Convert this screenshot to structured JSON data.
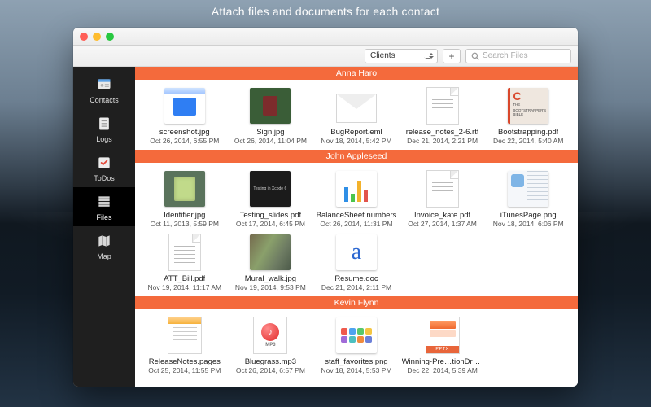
{
  "banner": "Attach files and documents for each contact",
  "toolbar": {
    "selector_value": "Clients",
    "plus_label": "+",
    "search_placeholder": "Search Files"
  },
  "sidebar": {
    "items": [
      {
        "key": "contacts",
        "label": "Contacts"
      },
      {
        "key": "logs",
        "label": "Logs"
      },
      {
        "key": "todos",
        "label": "ToDos"
      },
      {
        "key": "files",
        "label": "Files"
      },
      {
        "key": "map",
        "label": "Map"
      }
    ],
    "active": "files"
  },
  "sections": [
    {
      "title": "Anna Haro",
      "files": [
        {
          "name": "screenshot.jpg",
          "date": "Oct 26, 2014, 6:55 PM",
          "thumb": "ph-app"
        },
        {
          "name": "Sign.jpg",
          "date": "Oct 26, 2014, 11:04 PM",
          "thumb": "sign"
        },
        {
          "name": "BugReport.eml",
          "date": "Nov 18, 2014, 5:42 PM",
          "thumb": "envelope"
        },
        {
          "name": "release_notes_2-6.rtf",
          "date": "Dec 21, 2014, 2:21 PM",
          "thumb": "doc"
        },
        {
          "name": "Bootstrapping.pdf",
          "date": "Dec 22, 2014, 5:40 AM",
          "thumb": "book"
        }
      ]
    },
    {
      "title": "John Appleseed",
      "files": [
        {
          "name": "Identifier.jpg",
          "date": "Oct 11, 2013, 5:59 PM",
          "thumb": "photo"
        },
        {
          "name": "Testing_slides.pdf",
          "date": "Oct 17, 2014, 6:45 PM",
          "thumb": "slide"
        },
        {
          "name": "BalanceSheet.numbers",
          "date": "Oct 26, 2014, 11:31 PM",
          "thumb": "chart"
        },
        {
          "name": "Invoice_kate.pdf",
          "date": "Oct 27, 2014, 1:37 AM",
          "thumb": "doc"
        },
        {
          "name": "iTunesPage.png",
          "date": "Nov 18, 2014, 6:06 PM",
          "thumb": "webpg"
        },
        {
          "name": "ATT_Bill.pdf",
          "date": "Nov 19, 2014, 11:17 AM",
          "thumb": "doc"
        },
        {
          "name": "Mural_walk.jpg",
          "date": "Nov 19, 2014, 9:53 PM",
          "thumb": "mural"
        },
        {
          "name": "Resume.doc",
          "date": "Dec 21, 2014, 2:11 PM",
          "thumb": "letter"
        }
      ]
    },
    {
      "title": "Kevin Flynn",
      "files": [
        {
          "name": "ReleaseNotes.pages",
          "date": "Oct 25, 2014, 11:55 PM",
          "thumb": "pages"
        },
        {
          "name": "Bluegrass.mp3",
          "date": "Oct 26, 2014, 6:57 PM",
          "thumb": "mp3"
        },
        {
          "name": "staff_favorites.png",
          "date": "Nov 18, 2014, 5:53 PM",
          "thumb": "favicons"
        },
        {
          "name": "Winning-Pre…tionDraft.pptx",
          "date": "Dec 22, 2014, 5:39 AM",
          "thumb": "pptx"
        }
      ]
    }
  ],
  "mp3_label": "MP3",
  "pptx_label": "PPTX",
  "book_text": {
    "title": "THE",
    "sub": "BOOTSTRAPPER'S BIBLE"
  },
  "fav_colors": [
    "#ef5a4d",
    "#4da3ef",
    "#58c76b",
    "#f4c542",
    "#a06bd8",
    "#4dc0c0",
    "#f08a3c",
    "#6b7fd8"
  ]
}
